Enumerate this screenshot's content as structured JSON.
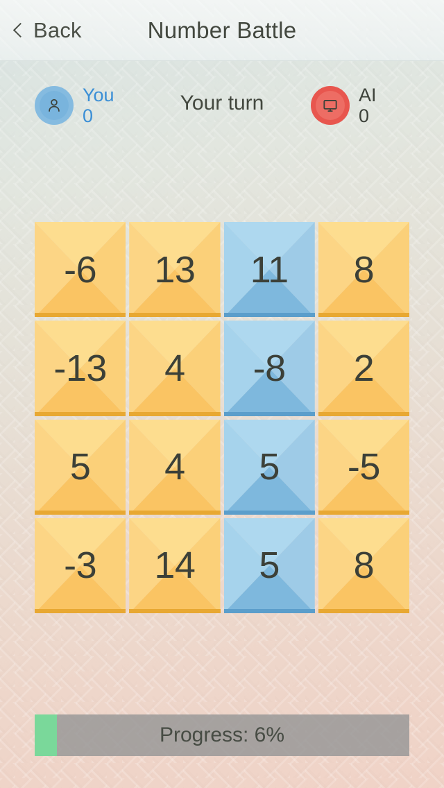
{
  "header": {
    "back_label": "Back",
    "title": "Number Battle",
    "back_icon": "chevron-left-icon"
  },
  "status": {
    "turn_text": "Your turn",
    "you": {
      "name": "You",
      "score": "0",
      "icon": "person-icon",
      "color": "#3b8fd6",
      "avatar_color": "#85bbe0"
    },
    "ai": {
      "name": "AI",
      "score": "0",
      "icon": "monitor-icon",
      "color": "#3d423a",
      "avatar_color": "#e8564e"
    }
  },
  "board": {
    "rows": 4,
    "cols": 4,
    "orange_color": "#fbd079",
    "blue_color": "#9ecbe7",
    "tiles": [
      {
        "value": "-6",
        "owner": "orange"
      },
      {
        "value": "13",
        "owner": "orange"
      },
      {
        "value": "11",
        "owner": "blue"
      },
      {
        "value": "8",
        "owner": "orange"
      },
      {
        "value": "-13",
        "owner": "orange"
      },
      {
        "value": "4",
        "owner": "orange"
      },
      {
        "value": "-8",
        "owner": "blue"
      },
      {
        "value": "2",
        "owner": "orange"
      },
      {
        "value": "5",
        "owner": "orange"
      },
      {
        "value": "4",
        "owner": "orange"
      },
      {
        "value": "5",
        "owner": "blue"
      },
      {
        "value": "-5",
        "owner": "orange"
      },
      {
        "value": "-3",
        "owner": "orange"
      },
      {
        "value": "14",
        "owner": "orange"
      },
      {
        "value": "5",
        "owner": "blue"
      },
      {
        "value": "8",
        "owner": "orange"
      }
    ]
  },
  "progress": {
    "label": "Progress: 6%",
    "percent": 6,
    "fill_color": "#7ad89a",
    "track_color": "#969696"
  }
}
